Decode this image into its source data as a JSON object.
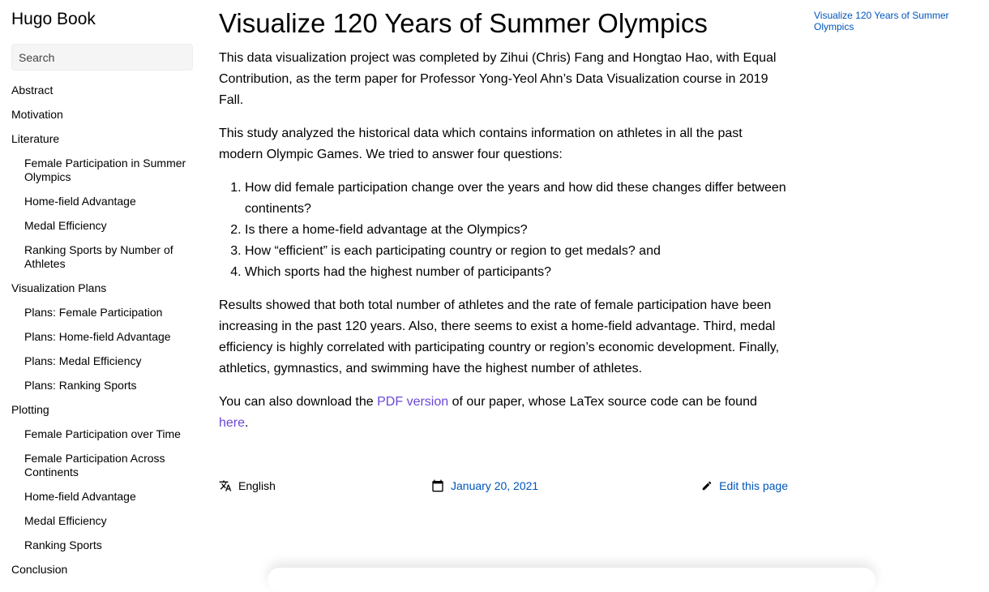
{
  "brand": "Hugo Book",
  "search": {
    "placeholder": "Search"
  },
  "nav": {
    "abstract": "Abstract",
    "motivation": "Motivation",
    "literature": "Literature",
    "literature_items": [
      "Female Participation in Summer Olympics",
      "Home-field Advantage",
      "Medal Efficiency",
      "Ranking Sports by Number of Athletes"
    ],
    "visualization_plans": "Visualization Plans",
    "plans_items": [
      "Plans: Female Participation",
      "Plans: Home-field Advantage",
      "Plans: Medal Efficiency",
      "Plans: Ranking Sports"
    ],
    "plotting": "Plotting",
    "plotting_items": [
      "Female Participation over Time",
      "Female Participation Across Continents",
      "Home-field Advantage",
      "Medal Efficiency",
      "Ranking Sports"
    ],
    "conclusion": "Conclusion"
  },
  "main": {
    "title": "Visualize 120 Years of Summer Olympics",
    "paragraph1": "This data visualization project was completed by Zihui (Chris) Fang and Hongtao Hao, with Equal Contribution, as the term paper for Professor Yong-Yeol Ahn’s Data Visualization course in 2019 Fall.",
    "paragraph2": "This study analyzed the historical data which contains information on athletes in all the past modern Olympic Games. We tried to answer four questions:",
    "questions": [
      "How did female participation change over the years and how did these changes differ between continents?",
      "Is there a home-field advantage at the Olympics?",
      "How “efficient” is each participating country or region to get medals? and",
      "Which sports had the highest number of participants?"
    ],
    "paragraph3": "Results showed that both total number of athletes and the rate of female participation have been increasing in the past 120 years. Also, there seems to exist a home-field advantage. Third, medal efficiency is highly correlated with participating country or region’s economic development. Finally, athletics, gymnastics, and swimming have the highest number of athletes.",
    "download_prefix": "You can also download the ",
    "pdf_link": "PDF version",
    "download_middle": " of our paper, whose LaTex source code can be found ",
    "here_link": "here",
    "download_suffix": "."
  },
  "footer": {
    "language": "English",
    "date": "January 20, 2021",
    "edit": "Edit this page"
  },
  "toc": {
    "item": "Visualize 120 Years of Summer Olympics"
  },
  "colors": {
    "link_purple": "#6b47d6",
    "link_blue": "#0055bb"
  },
  "icons": {
    "language": "translate-icon",
    "date": "calendar-icon",
    "edit": "pencil-icon"
  }
}
